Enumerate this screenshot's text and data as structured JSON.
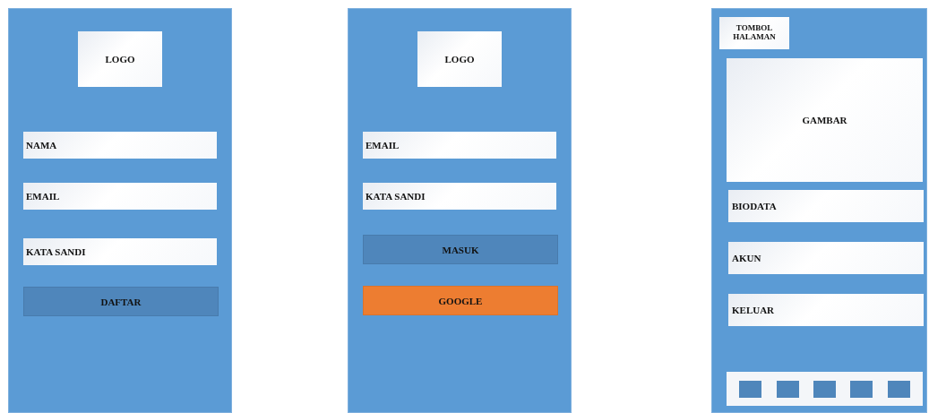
{
  "screens": [
    {
      "kind": "register",
      "items": [
        {
          "kind": "logo",
          "label": "LOGO"
        },
        {
          "kind": "field",
          "label": "NAMA"
        },
        {
          "kind": "field",
          "label": "EMAIL"
        },
        {
          "kind": "field",
          "label": "KATA SANDI"
        },
        {
          "kind": "button",
          "label": "DAFTAR",
          "color": "#4f86bb"
        }
      ]
    },
    {
      "kind": "login",
      "items": [
        {
          "kind": "logo",
          "label": "LOGO"
        },
        {
          "kind": "field",
          "label": "EMAIL"
        },
        {
          "kind": "field",
          "label": "KATA SANDI"
        },
        {
          "kind": "button",
          "label": "MASUK",
          "color": "#4f86bb"
        },
        {
          "kind": "button",
          "label": "GOOGLE",
          "color": "#ed7d31"
        }
      ]
    },
    {
      "kind": "profile",
      "items": [
        {
          "kind": "page-button",
          "label": "TOMBOL HALAMAN"
        },
        {
          "kind": "image",
          "label": "GAMBAR"
        },
        {
          "kind": "menu",
          "label": "BIODATA"
        },
        {
          "kind": "menu",
          "label": "AKUN"
        },
        {
          "kind": "menu",
          "label": "KELUAR"
        },
        {
          "kind": "navbar"
        }
      ]
    }
  ]
}
